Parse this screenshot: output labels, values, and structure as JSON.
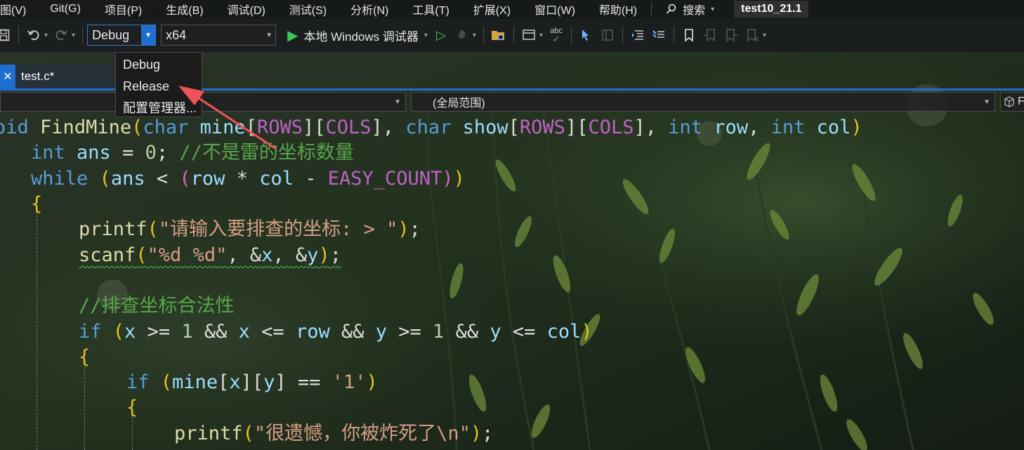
{
  "menu": {
    "items": [
      "图(V)",
      "Git(G)",
      "项目(P)",
      "生成(B)",
      "调试(D)",
      "测试(S)",
      "分析(N)",
      "工具(T)",
      "扩展(X)",
      "窗口(W)",
      "帮助(H)"
    ],
    "search_label": "搜索",
    "project_title": "test10_21.1"
  },
  "toolbar": {
    "configuration": "Debug",
    "platform": "x64",
    "run_label": "本地 Windows 调试器"
  },
  "config_dropdown": {
    "options": [
      "Debug",
      "Release",
      "配置管理器..."
    ]
  },
  "tabs": [
    {
      "label": "test.c*"
    }
  ],
  "navbar": {
    "scope": "(全局范围)",
    "right_label": "F"
  },
  "code_lines": [
    "oid FindMine(char mine[ROWS][COLS], char show[ROWS][COLS], int row, int col)",
    "int ans = 0; //不是雷的坐标数量",
    "while (ans < (row * col - EASY_COUNT))",
    "{",
    "printf(\"请输入要排查的坐标: > \");",
    "scanf(\"%d %d\", &x, &y);",
    "//排查坐标合法性",
    "if (x >= 1 && x <= row && y >= 1 && y <= col)",
    "{",
    "if (mine[x][y] == '1')",
    "{",
    "printf(\"很遗憾，你被炸死了\\n\");"
  ],
  "colors": {
    "accent": "#1f6fd1",
    "play_green": "#3fc552",
    "annotation_arrow": "#f0525b",
    "keyword": "#569cd6",
    "comment": "#57a64a",
    "string": "#d69d85",
    "function": "#dcdcaa"
  },
  "icons": [
    "save-icon",
    "undo-icon",
    "redo-icon",
    "play-icon",
    "play-outline-icon",
    "hot-reload-icon",
    "folder-search-icon",
    "browser-icon",
    "spellcheck-icon",
    "cursor-icon",
    "panel-icon",
    "indent-icon",
    "comment-icon",
    "bookmark-icon",
    "bookmark-prev-icon",
    "bookmark-next-icon",
    "bookmark-clear-icon",
    "search-icon",
    "close-icon",
    "cube-icon"
  ]
}
